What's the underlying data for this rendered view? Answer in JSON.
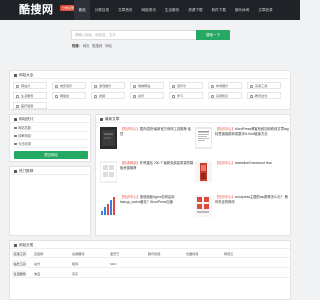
{
  "brand": {
    "logo": "酷搜网",
    "badge": "分类目录"
  },
  "nav": [
    "首页",
    "分类目录",
    "文章资讯",
    "网络资讯",
    "生活服务",
    "资源下载",
    "软件下载",
    "娱乐休闲",
    "文章收录"
  ],
  "search": {
    "placeholder": "请输入网址、网站名、文字",
    "button": "搜索一下",
    "hot_label": "热搜:",
    "hot_words": [
      "网页",
      "酷搜网",
      "网站"
    ]
  },
  "categories_panel": {
    "title": "网站大全",
    "items": [
      "网站分",
      "电影音乐",
      "游戏娱乐",
      "购物网站",
      "音乐乐",
      "休闲娱乐",
      "实用工具",
      "生活服务",
      "网络文",
      "视频",
      "资讯",
      "学习",
      "实用知识",
      "教育文化",
      "医疗健康"
    ]
  },
  "stats_panel": {
    "title": "网站统计",
    "rows": [
      {
        "label": "网站总数:",
        "value": ""
      },
      {
        "label": "待审网站:",
        "value": ""
      },
      {
        "label": "今日收录:",
        "value": ""
      }
    ],
    "button": "提交网站"
  },
  "friends_panel": {
    "title": "热门推荐"
  },
  "articles_panel": {
    "title": "最新文章",
    "items": [
      {
        "tag": "【知识中心】",
        "text": "国内/国外最新官方修改工具推荐 给您"
      },
      {
        "tag": "【知识中心】",
        "text": "WordPress博客系统如何修改文章tag标签链接跳转成数字id.html链接方法"
      },
      {
        "tag": "【精选网站】",
        "text": "外贸建站 200 个最新免费高质量的模板资源推荐"
      },
      {
        "tag": "【知识中心】",
        "text": "basketball hardwood floor"
      },
      {
        "tag": "【知识中心】",
        "text": "宝塔面板Nginx如何启用fastcgi_cache缓存？WordPress加速"
      },
      {
        "tag": "【知识中心】",
        "text": "wordpress主题的wp推荐怎么办？ 教你完全的修改"
      }
    ]
  },
  "sites_panel": {
    "title": "网站分类",
    "rows": [
      {
        "head": "实用工具",
        "cells": [
          "百度网",
          "谷歌翻译",
          "爱奇艺",
          "腾讯视频",
          "优酷视频",
          "网易云"
        ]
      },
      {
        "head": "站长工具",
        "cells": [
          "站长",
          "极简",
          "SEO"
        ]
      },
      {
        "head": "生活服务",
        "cells": [
          "淘宝",
          "京东"
        ]
      }
    ]
  }
}
